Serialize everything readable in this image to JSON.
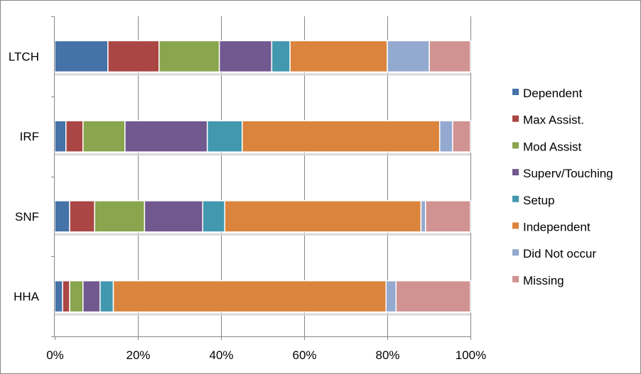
{
  "chart_data": {
    "type": "bar",
    "orientation": "horizontal",
    "stacked": "percent",
    "title": "",
    "xlabel": "",
    "ylabel": "",
    "categories": [
      "LTCH",
      "IRF",
      "SNF",
      "HHA"
    ],
    "xlim": [
      0,
      100
    ],
    "x_ticks": [
      0,
      20,
      40,
      60,
      80,
      100
    ],
    "x_tick_labels": [
      "0%",
      "20%",
      "40%",
      "60%",
      "80%",
      "100%"
    ],
    "grid": "vertical",
    "legend": "right",
    "series": [
      {
        "name": "Dependent",
        "color": "#4572A7",
        "values": [
          12.8,
          2.7,
          3.6,
          1.9
        ]
      },
      {
        "name": "Max Assist.",
        "color": "#AA4643",
        "values": [
          12.3,
          4.1,
          6.0,
          1.7
        ]
      },
      {
        "name": "Mod Assist",
        "color": "#89A54E",
        "values": [
          14.5,
          10.1,
          12.0,
          3.2
        ]
      },
      {
        "name": "Superv/Touching",
        "color": "#71588F",
        "values": [
          12.6,
          19.8,
          14.0,
          4.1
        ]
      },
      {
        "name": "Setup",
        "color": "#4198AF",
        "values": [
          4.4,
          8.4,
          5.3,
          3.2
        ]
      },
      {
        "name": "Independent",
        "color": "#DB843D",
        "values": [
          23.4,
          47.5,
          47.2,
          65.6
        ]
      },
      {
        "name": "Did Not occur",
        "color": "#93A9CF",
        "values": [
          10.1,
          3.1,
          1.1,
          2.4
        ]
      },
      {
        "name": "Missing",
        "color": "#D19392",
        "values": [
          9.9,
          4.3,
          10.8,
          17.9
        ]
      }
    ]
  }
}
